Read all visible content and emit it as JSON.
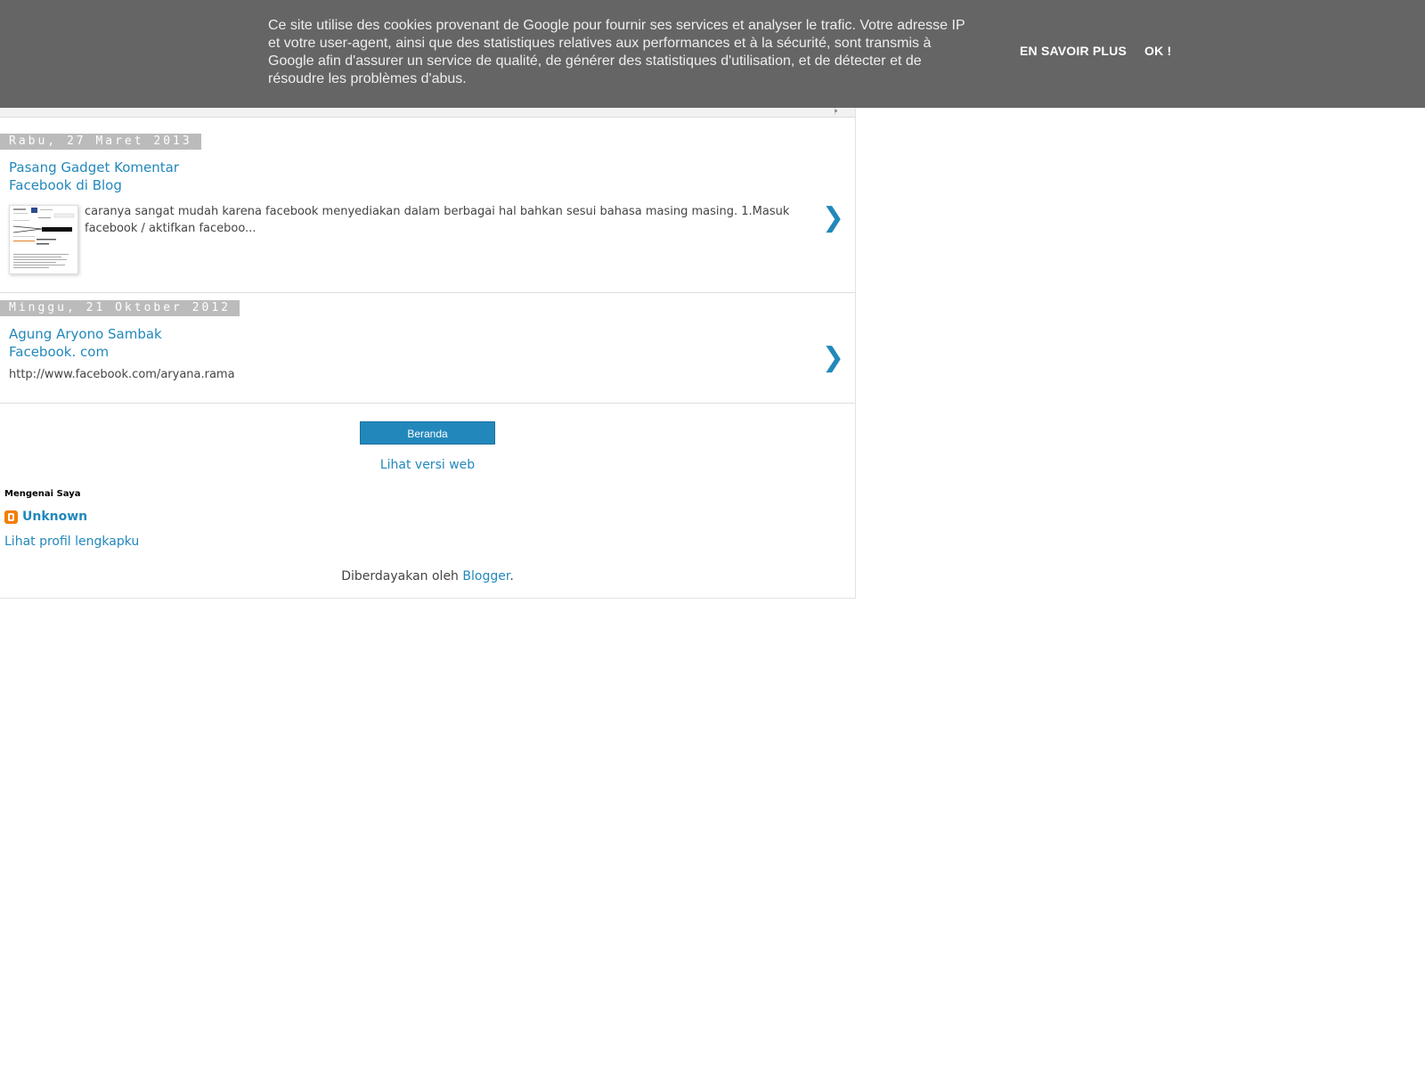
{
  "cookie_banner": {
    "message": "Ce site utilise des cookies provenant de Google pour fournir ses services et analyser le trafic. Votre adresse IP et votre user-agent, ainsi que des statistiques relatives aux performances et à la sécurité, sont transmis à Google afin d'assurer un service de qualité, de générer des statistiques d'utilisation, et de détecter et de résoudre les problèmes d'abus.",
    "learn_more_label": "EN SAVOIR PLUS",
    "ok_label": "OK !"
  },
  "posts": [
    {
      "date": "Rabu, 27 Maret 2013",
      "title": "Pasang Gadget Komentar Facebook di Blog",
      "snippet": "caranya sangat mudah karena facebook menyediakan dalam berbagai hal bahkan sesui bahasa masing masing. 1.Masuk facebook / aktifkan faceboo...",
      "has_thumbnail": true,
      "arrow": "❯"
    },
    {
      "date": "Minggu, 21 Oktober 2012",
      "title": "Agung Aryono Sambak Facebook. com",
      "snippet": "http://www.facebook.com/aryana.rama",
      "has_thumbnail": false,
      "arrow": "❯"
    }
  ],
  "footer": {
    "home_button": "Beranda",
    "web_version_link": "Lihat versi web",
    "about_title": "Mengenai Saya",
    "profile_name": "Unknown",
    "profile_link": "Lihat profil lengkapku",
    "powered_by_prefix": "Diberdayakan oleh ",
    "powered_by_link": "Blogger",
    "powered_by_suffix": "."
  },
  "colors": {
    "banner_bg": "#656565",
    "link": "#2288bb",
    "date_bg": "#bbbbbb",
    "blogger_orange": "#f57d00"
  },
  "icons": {
    "next_post": "chevron-right-icon",
    "blogger": "blogger-icon"
  }
}
